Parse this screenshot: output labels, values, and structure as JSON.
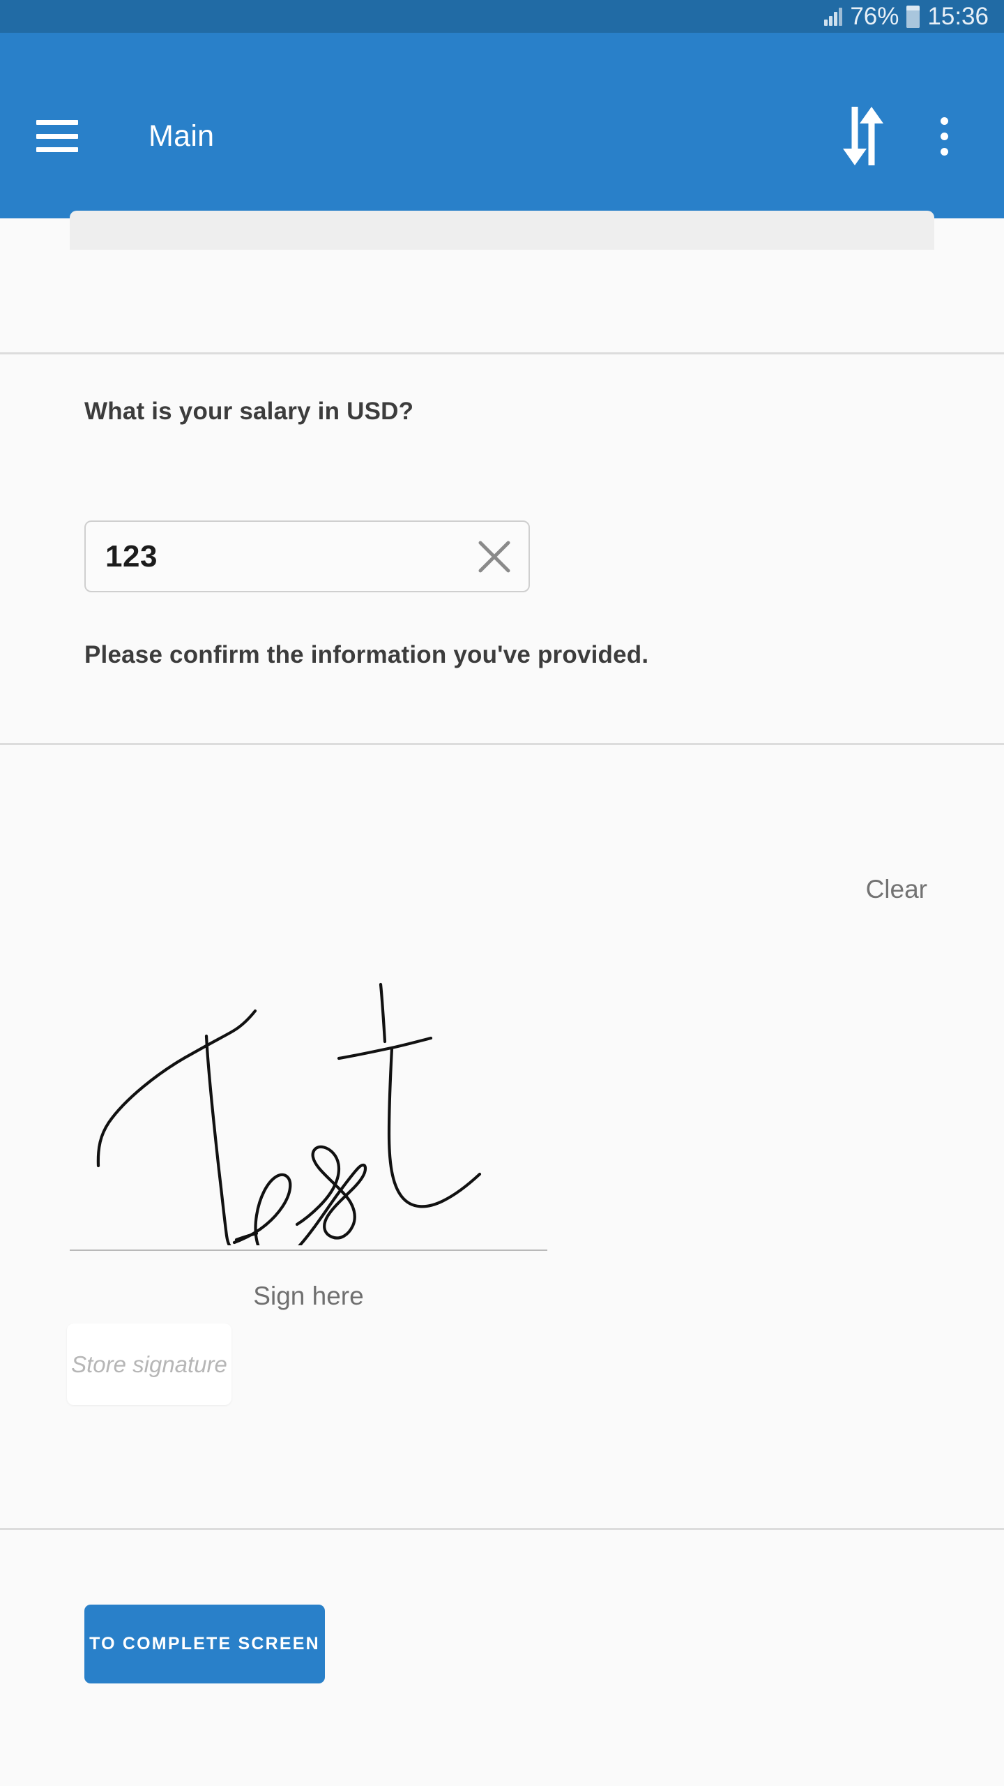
{
  "status_bar": {
    "signal_icon": "signal-bars-icon",
    "battery_percent": "76%",
    "battery_icon": "battery-icon",
    "time": "15:36"
  },
  "app_bar": {
    "menu_icon": "hamburger-menu-icon",
    "title": "Main",
    "sync_icon": "sync-up-down-arrows-icon",
    "overflow_icon": "overflow-menu-icon"
  },
  "salary_section": {
    "question": "What is your salary in USD?",
    "input_value": "123",
    "input_placeholder": "",
    "clear_icon": "close-x-icon"
  },
  "signature_section": {
    "question": "Please confirm the information you've provided.",
    "clear_label": "Clear",
    "sign_here_label": "Sign here",
    "store_button_label": "Store signature",
    "signature_text": "Test"
  },
  "footer": {
    "cta_label": "TO COMPLETE SCREEN"
  },
  "colors": {
    "status_bar": "#216ba5",
    "app_bar": "#2980c9",
    "accent": "#2980c9",
    "page_background": "#fafafa",
    "divider": "#dcdcdc"
  }
}
